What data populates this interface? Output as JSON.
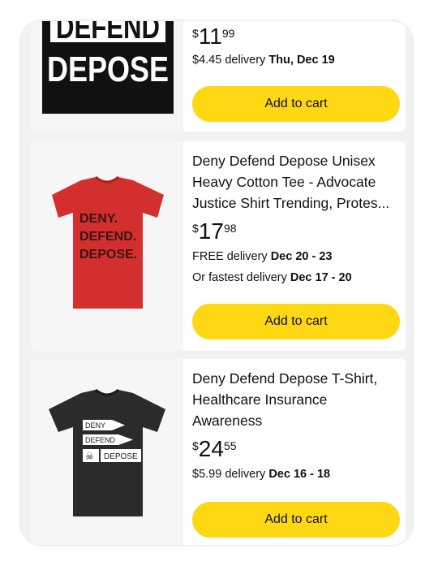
{
  "products": [
    {
      "price": {
        "symbol": "$",
        "whole": "11",
        "fraction": "99"
      },
      "delivery": {
        "prefix": "$4.45 delivery",
        "date": "Thu, Dec 19"
      },
      "add_to_cart": "Add to cart",
      "image_text": [
        "DEFEND",
        "DEPOSE"
      ]
    },
    {
      "title": "Deny Defend Depose Unisex Heavy Cotton Tee - Advocate Justice Shirt Trending, Protes...",
      "price": {
        "symbol": "$",
        "whole": "17",
        "fraction": "98"
      },
      "delivery": {
        "prefix": "FREE delivery",
        "date": "Dec 20 - 23"
      },
      "fastest": {
        "prefix": "Or fastest delivery",
        "date": "Dec 17 - 20"
      },
      "add_to_cart": "Add to cart",
      "image_text": [
        "DENY.",
        "DEFEND.",
        "DEPOSE."
      ],
      "shirt_color": "#d32f2f"
    },
    {
      "title": "Deny Defend Depose T-Shirt, Healthcare Insurance Awareness",
      "price": {
        "symbol": "$",
        "whole": "24",
        "fraction": "55"
      },
      "delivery": {
        "prefix": "$5.99 delivery",
        "date": "Dec 16 - 18"
      },
      "add_to_cart": "Add to cart",
      "image_text": [
        "DENY",
        "DEFEND",
        "DEPOSE"
      ],
      "shirt_color": "#2b2b2b"
    }
  ],
  "colors": {
    "button": "#ffd814",
    "background": "#f1f2f2"
  }
}
